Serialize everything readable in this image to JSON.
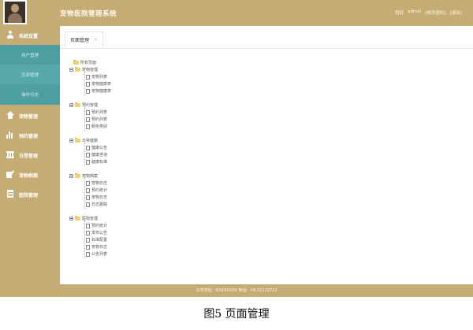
{
  "header": {
    "title": "宠物医院管理系统",
    "links": [
      "您好",
      "admin",
      "[修改密码]",
      "[退出]"
    ]
  },
  "sidebar": {
    "items": [
      {
        "label": "系统设置",
        "icon": "user-icon",
        "submenu": [
          "用户管理",
          "页面管理",
          "操作日志"
        ],
        "active_sub": 1
      },
      {
        "label": "宠物管理",
        "icon": "home-icon"
      },
      {
        "label": "预约管理",
        "icon": "bar-chart-icon"
      },
      {
        "label": "日常管理",
        "icon": "building-icon"
      },
      {
        "label": "宠物档案",
        "icon": "edit-icon"
      },
      {
        "label": "医院管理",
        "icon": "document-icon"
      }
    ]
  },
  "tabs": [
    {
      "label": "页面管理",
      "close": "×"
    }
  ],
  "tree": {
    "root": "所有页面",
    "groups": [
      {
        "label": "宠物管理",
        "children": [
          "宠物列表",
          "宠物健康表",
          "宠物健康表"
        ]
      },
      {
        "label": "预约管理",
        "children": [
          "预约列表",
          "预约列表",
          "服务类别"
        ]
      },
      {
        "label": "日常健康",
        "children": [
          "健康公告",
          "健康咨询",
          "健康标准"
        ]
      },
      {
        "label": "宠物档案",
        "children": [
          "宠物日志",
          "预约统计",
          "宠物日志",
          "日志跟踪"
        ]
      },
      {
        "label": "医院管理",
        "children": [
          "预约统计",
          "发布公告",
          "标准配置",
          "宠物日志",
          "公告列表"
        ]
      }
    ]
  },
  "footer": {
    "text": "公司地址：XXXXXXXX 电话：XX-11112222"
  },
  "caption": "图5  页面管理",
  "colors": {
    "brand": "#c5ab74",
    "submenu": "#4e9fa1",
    "folder": "#f2d06b"
  }
}
